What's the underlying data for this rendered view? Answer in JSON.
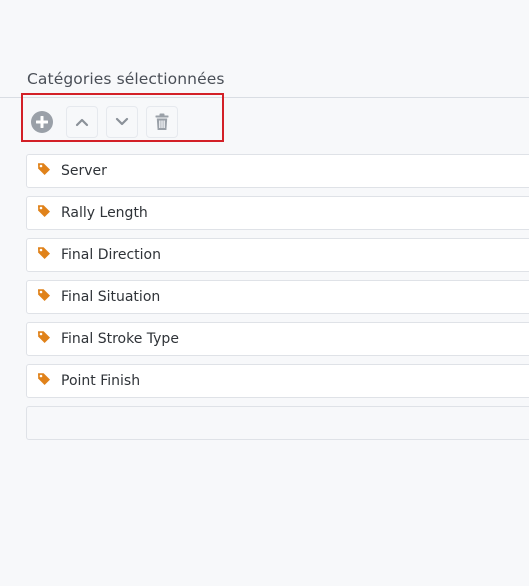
{
  "section": {
    "title": "Catégories sélectionnées"
  },
  "toolbar": {
    "buttons": [
      {
        "name": "add",
        "icon": "plus-circle-icon"
      },
      {
        "name": "move-up",
        "icon": "chevron-up-icon"
      },
      {
        "name": "move-down",
        "icon": "chevron-down-icon"
      },
      {
        "name": "delete",
        "icon": "trash-icon"
      }
    ],
    "highlight_color": "#d32027"
  },
  "categories": {
    "icon": "tag-icon",
    "icon_color": "#e0821a",
    "items": [
      {
        "label": "Server"
      },
      {
        "label": "Rally Length"
      },
      {
        "label": "Final Direction"
      },
      {
        "label": "Final Situation"
      },
      {
        "label": "Final Stroke Type"
      },
      {
        "label": "Point Finish"
      }
    ],
    "new_item_value": ""
  }
}
